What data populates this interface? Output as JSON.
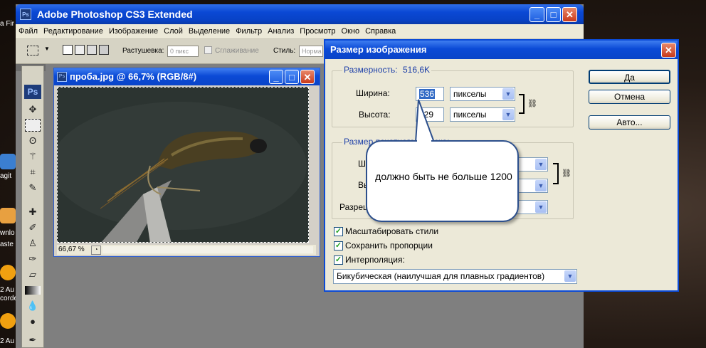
{
  "desktop": {
    "labels": [
      "a Fir",
      "agit",
      "wnlo",
      "aste",
      "2 Au",
      "corde",
      "2 Au"
    ]
  },
  "photoshop": {
    "title": "Adobe Photoshop CS3 Extended",
    "menu": [
      "Файл",
      "Редактирование",
      "Изображение",
      "Слой",
      "Выделение",
      "Фильтр",
      "Анализ",
      "Просмотр",
      "Окно",
      "Справка"
    ],
    "options": {
      "feather_label": "Растушевка:",
      "feather_value": "0 пикс",
      "antialias_label": "Сглаживание",
      "style_label": "Стиль:",
      "style_value": "Норма"
    },
    "toolbox_logo": "Ps",
    "document": {
      "title": "проба.jpg @ 66,7% (RGB/8#)",
      "zoom": "66,67 %"
    }
  },
  "dialog": {
    "title": "Размер изображения",
    "pixel_dimensions": {
      "legend": "Размерность:",
      "size": "516,6K",
      "width_label": "Ширина:",
      "width_value": "536",
      "height_label": "Высота:",
      "height_value": "329",
      "width_unit": "пикселы",
      "height_unit": "пикселы"
    },
    "document_size": {
      "legend": "Размер печатного оттиска:",
      "width_label_partial": "Ши",
      "height_label_partial": "Вы",
      "resolution_label_partial": "Разреш"
    },
    "buttons": {
      "ok": "Да",
      "cancel": "Отмена",
      "auto": "Авто..."
    },
    "checkboxes": [
      {
        "label": "Масштабировать стили",
        "checked": true
      },
      {
        "label": "Сохранить пропорции",
        "checked": true
      },
      {
        "label": "Интерполяция:",
        "checked": true
      }
    ],
    "interpolation": "Бикубическая (наилучшая для плавных градиентов)"
  },
  "callout": {
    "text": "должно быть не больше 1200"
  }
}
